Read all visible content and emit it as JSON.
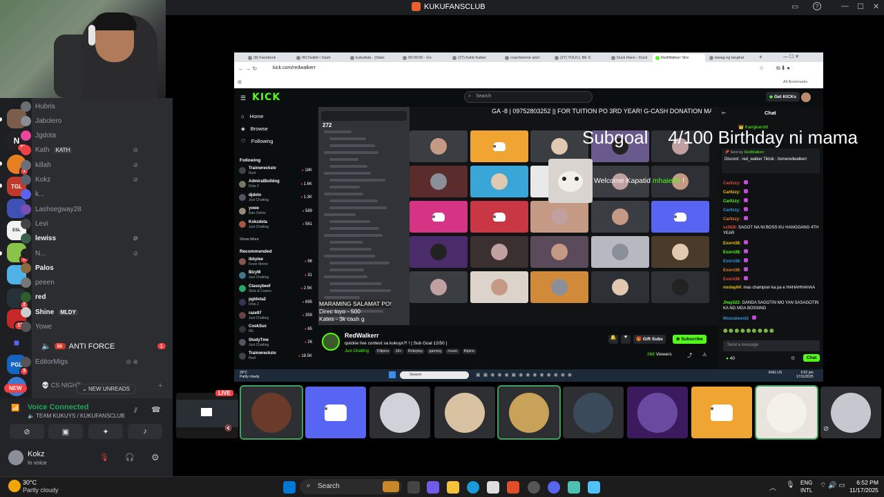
{
  "window": {
    "title": "KUKUFANSCLUB"
  },
  "discord": {
    "members": [
      {
        "name": "Hubris",
        "color": "#6b6f76"
      },
      {
        "name": "Jabolero",
        "color": "#8a8d93"
      },
      {
        "name": "Jgdota",
        "color": "#eb459e"
      },
      {
        "name": "Kath",
        "tag": "KATH",
        "color": "#ed4245"
      },
      {
        "name": "killah",
        "color": "#6b6f76"
      },
      {
        "name": "Kokz",
        "color": "#5a6270"
      },
      {
        "name": "k...",
        "color": "#5865f2"
      },
      {
        "name": "Lashsegway28",
        "color": "#7a4fb5"
      },
      {
        "name": "Levi",
        "color": "#444"
      },
      {
        "name": "lewiss",
        "color": "#3a5f4a",
        "bright": true
      },
      {
        "name": "N...",
        "color": "#222"
      },
      {
        "name": "Palos",
        "color": "#8b6a3e",
        "bright": true
      },
      {
        "name": "peeen",
        "color": "#777"
      },
      {
        "name": "red",
        "color": "#2e5e2e",
        "bright": true
      },
      {
        "name": "Shine",
        "tag": "MLDY",
        "color": "#ccc",
        "bright": true
      },
      {
        "name": "Yowe",
        "color": "#555"
      }
    ],
    "channel_antiforce": "ANTI FORCE",
    "antiforce_badge": "1",
    "member_editor": "EditorMigs",
    "cs_night": "CS NIGHT",
    "new_label": "NEW",
    "unreads_label": "NEW UNREADS",
    "voice_status": "Voice Connected",
    "voice_channel": "TEAM KUKUYS / KUKUFANSCLUB",
    "user_name": "Kokz",
    "user_status": "In voice",
    "rail_badges": [
      "37",
      "1",
      "2",
      "2",
      "120",
      "3"
    ]
  },
  "browser": {
    "tabs": [
      "(8) Facebook",
      "IRLToolkit • Dash",
      "kukudota - (Stats",
      "00:00:00 - Go",
      "(27) Kahit Kailan",
      "coachmeme and i",
      "(27) YOU'LL BE S",
      "Duck Race - Duck",
      "RedWalkerr Stre",
      "tawag ng tanghal"
    ],
    "url": "kick.com/redwalkerr",
    "bookmarks_label": "All Bookmarks"
  },
  "kick": {
    "logo": "KICK",
    "search_placeholder": "Search",
    "get_kicks": "Get KICKs",
    "nav": [
      "Home",
      "Browse",
      "Following"
    ],
    "following_label": "Following",
    "recommended_label": "Recommended",
    "show_more": "Show More",
    "following": [
      {
        "name": "Trainwreckstv",
        "game": "Rust",
        "viewers": "18K"
      },
      {
        "name": "AdmiralBulldog",
        "game": "Dota 2",
        "viewers": "1.6K"
      },
      {
        "name": "djdoto",
        "game": "Just Chatting",
        "viewers": "1.3K"
      },
      {
        "name": "yowe",
        "game": "Ran Online",
        "viewers": "589"
      },
      {
        "name": "Kokzdota",
        "game": "Just Chatting",
        "viewers": "561"
      }
    ],
    "recommended": [
      {
        "name": "ibbytee",
        "game": "Fever Meme",
        "viewers": "96"
      },
      {
        "name": "BlzyM",
        "game": "Just Chatting",
        "viewers": "31"
      },
      {
        "name": "Classybeef",
        "game": "Slots & Casino",
        "viewers": "2.5K"
      },
      {
        "name": "pgldota2",
        "game": "Dota 2",
        "viewers": "895"
      },
      {
        "name": "raze97",
        "game": "Just Chatting",
        "viewers": "358"
      },
      {
        "name": "CookSux",
        "game": "IRL",
        "viewers": "65"
      },
      {
        "name": "StudyTme",
        "game": "Just Chatting",
        "viewers": "26"
      },
      {
        "name": "Trainwreckstv",
        "game": "Rust",
        "viewers": "18.5K"
      }
    ],
    "ticker": "GA -8 | 09752803252 || FOR TUITION PO 3RD YEAR! G-CASH DONATION MARAMIN",
    "subgoal_label": "Subgoal",
    "subgoal_text": "4/100 Birthday ni mama",
    "welcome_text": "Welcome Kapatid",
    "welcome_user": "mhaie94",
    "overlay_lines": [
      "MARAMING SALAMAT PO!",
      "Direc toyo - 500",
      "Kates - 3k cash g"
    ],
    "discord_count": "272",
    "streamer": "RedWalkerr",
    "stream_title": "quickie live contest sa kukuys?! ! | Sub Goal 12/50 |",
    "stream_category": "Just Chatting",
    "stream_tags": [
      "Filipino",
      "18+",
      "Roleplay",
      "gaming",
      "music",
      "filipino"
    ],
    "viewers": "268",
    "viewers_label": "Viewers",
    "gift_subs": "Gift Subs",
    "subscribe": "Subscribe",
    "chat_title": "Chat",
    "chat_pinned_user": "RedWalkerr",
    "chat_pinned_text": "Discord : red_walker Tiktok : itsmeredwalkerr",
    "chat_messages": [
      {
        "user": "Carltzzy:",
        "text": ""
      },
      {
        "user": "Carltzzy:",
        "text": ""
      },
      {
        "user": "Carltzzy:",
        "text": ""
      },
      {
        "user": "Carltzzy:",
        "text": ""
      },
      {
        "user": "Carltzzy:",
        "text": ""
      },
      {
        "user": "ssi928:",
        "text": "SAGOT NA NI BOSS KU HANGGANG 4TH YEAR"
      },
      {
        "user": "Exorn38:",
        "text": ""
      },
      {
        "user": "Exorn38:",
        "text": ""
      },
      {
        "user": "Exorn38:",
        "text": ""
      },
      {
        "user": "Exorn38:",
        "text": ""
      },
      {
        "user": "Exorn38:",
        "text": ""
      },
      {
        "user": "noslay04:",
        "text": "mas champion ka pa e HAHAHHAHAA"
      },
      {
        "user": "Jhay322:",
        "text": "GANDA SAGOTIN MO YAN SASAGOTIN KA NG MGA BOSSING"
      },
      {
        "user": "Mozzabeest2",
        "text": ""
      }
    ],
    "send_placeholder": "Send a message",
    "chat_button": "Chat",
    "kick_points": "40",
    "inner_weather": "29°C",
    "inner_weather_desc": "Partly cloudy",
    "inner_search": "Search",
    "inner_lang": "ENG US",
    "inner_time": "6:52 pm",
    "inner_date": "17/11/2025"
  },
  "live_tile": {
    "label": "LIVE"
  },
  "taskbar": {
    "weather_temp": "30°C",
    "weather_desc": "Partly cloudy",
    "search_placeholder": "Search",
    "lang": "ENG",
    "lang_sub": "INTL",
    "time": "6:52 PM",
    "date": "11/17/2025"
  },
  "colors": {
    "kick_green": "#53fc18",
    "discord_blurple": "#5865f2",
    "voice_green": "#23a55a",
    "alert_red": "#f23f43"
  }
}
